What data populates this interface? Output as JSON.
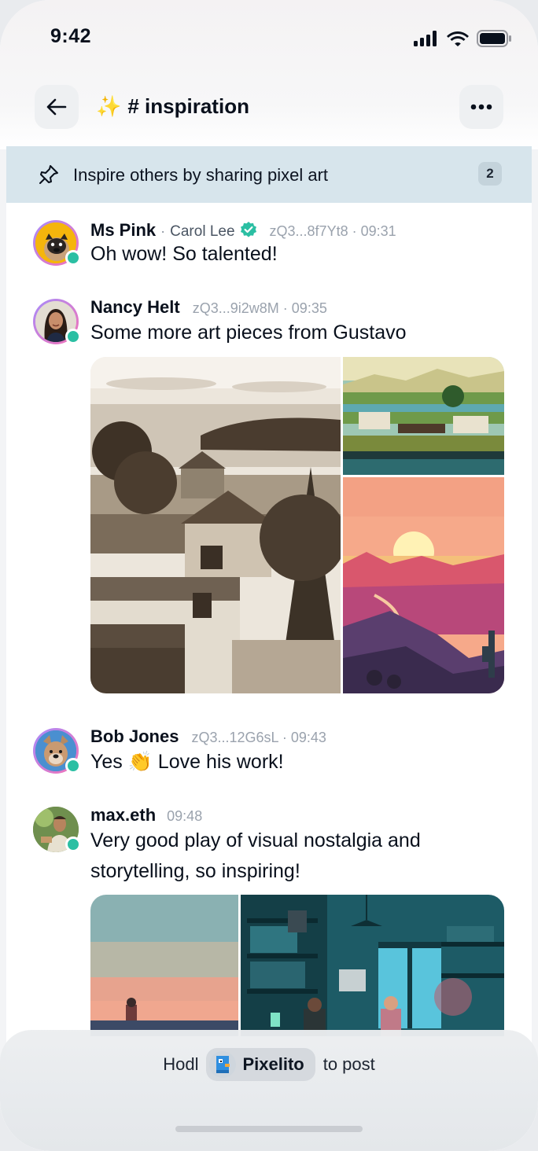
{
  "status_bar": {
    "time": "9:42"
  },
  "header": {
    "back_icon": "arrow-left-icon",
    "emoji": "✨",
    "channel_name": "# inspiration",
    "more_icon": "ellipsis-icon"
  },
  "pinned": {
    "icon": "pin-icon",
    "text": "Inspire others by sharing pixel art",
    "count": "2"
  },
  "messages": [
    {
      "author": "Ms Pink",
      "separator": "·",
      "nickname": "Carol Lee",
      "verified": true,
      "address": "zQ3...8f7Yt8",
      "time": "09:31",
      "text": "Oh wow! So talented!"
    },
    {
      "author": "Nancy Helt",
      "address": "zQ3...9i2w8M",
      "time": "09:35",
      "text": "Some more art pieces from Gustavo"
    },
    {
      "author": "Bob Jones",
      "address": "zQ3...12G6sL",
      "time": "09:43",
      "text": "Yes 👏 Love his work!"
    },
    {
      "author": "max.eth",
      "time": "09:48",
      "text": "Very good play of visual nostalgia and storytelling, so inspiring!"
    }
  ],
  "composer": {
    "prefix": "Hodl",
    "token_name": "Pixelito",
    "suffix": "to post"
  },
  "colors": {
    "online": "#2bbfa3",
    "verified": "#2bbfa3",
    "pinned_bg": "#d7e5ec"
  }
}
